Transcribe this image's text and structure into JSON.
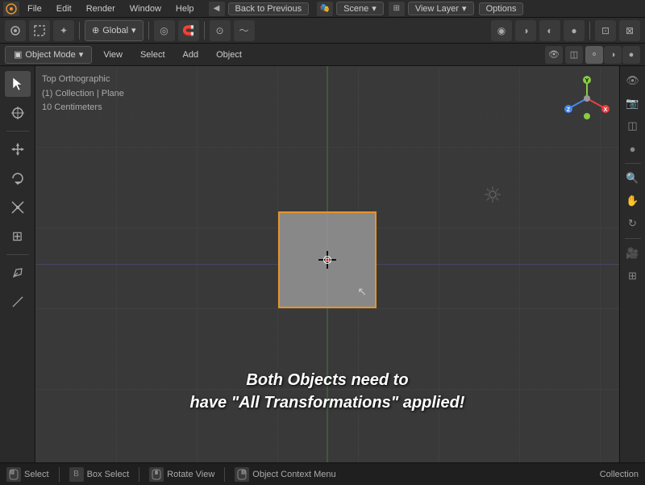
{
  "window": {
    "title": "Blender"
  },
  "top_menu": {
    "items": [
      "Blender",
      "File",
      "Edit",
      "Render",
      "Window",
      "Help"
    ],
    "back_button": "Back to Previous",
    "scene_label": "Scene",
    "view_layer_label": "View Layer",
    "options_label": "Options"
  },
  "toolbar2": {
    "mode": "Global",
    "icons": [
      "⟲",
      "↔",
      "⌖",
      "~"
    ]
  },
  "toolbar3": {
    "mode": "Object Mode",
    "buttons": [
      "View",
      "Select",
      "Add",
      "Object"
    ]
  },
  "viewport": {
    "label_1": "Top Orthographic",
    "label_2": "(1) Collection | Plane",
    "label_3": "10 Centimeters"
  },
  "message": {
    "line1": "Both Objects need to",
    "line2": "have \"All Transformations\" applied!"
  },
  "left_tools": [
    {
      "name": "select-tool",
      "icon": "↖",
      "active": true
    },
    {
      "name": "cursor-tool",
      "icon": "⊕"
    },
    {
      "name": "move-tool",
      "icon": "✛"
    },
    {
      "name": "rotate-tool",
      "icon": "↻"
    },
    {
      "name": "scale-tool",
      "icon": "⤢"
    },
    {
      "name": "transform-tool",
      "icon": "⊞"
    },
    {
      "name": "annotate-tool",
      "icon": "✏"
    },
    {
      "name": "measure-tool",
      "icon": "📐"
    }
  ],
  "right_tools": [
    {
      "name": "view-icon",
      "icon": "👁"
    },
    {
      "name": "render-icon",
      "icon": "📷"
    },
    {
      "name": "overlay-icon",
      "icon": "◫"
    },
    {
      "name": "shading-icon",
      "icon": "●"
    },
    {
      "name": "grid-icon",
      "icon": "⊞"
    },
    {
      "name": "zoom-icon",
      "icon": "🔍"
    },
    {
      "name": "pan-icon",
      "icon": "✋"
    },
    {
      "name": "camera-icon",
      "icon": "🎥"
    },
    {
      "name": "table-icon",
      "icon": "⊞"
    }
  ],
  "status_bar": {
    "select_label": "Select",
    "box_select_label": "Box Select",
    "rotate_view_label": "Rotate View",
    "object_context_label": "Object Context Menu",
    "collection_label": "Collection"
  },
  "gizmo": {
    "y_color": "#88cc44",
    "x_color": "#e84040",
    "z_color": "#4488ee",
    "dot_color": "#88cc44"
  }
}
